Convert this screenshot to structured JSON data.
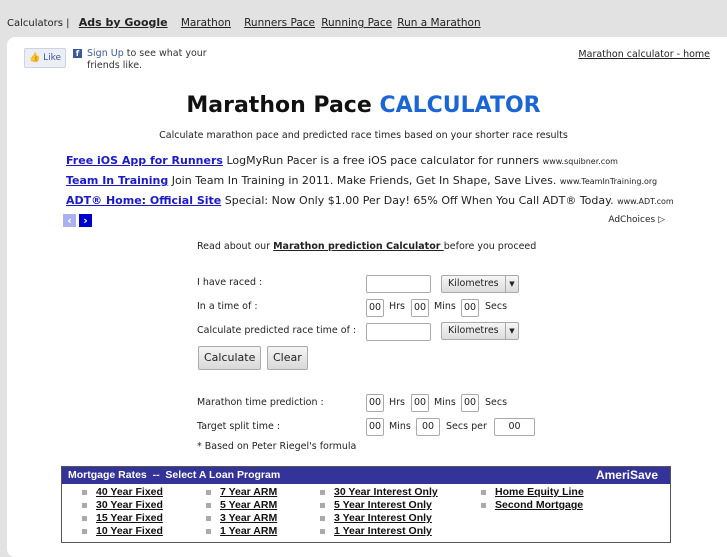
{
  "topnav": {
    "calculators": "Calculators |",
    "ads_by_google": "Ads by Google",
    "links": [
      "Marathon",
      "Runners Pace",
      "Running Pace",
      "Run a Marathon"
    ]
  },
  "social": {
    "like": "Like",
    "signup": "Sign Up",
    "signup_rest": " to see what your friends like."
  },
  "home_link": "Marathon calculator - home",
  "title": {
    "part1": "Marathon Pace ",
    "part2": "CALCULATOR"
  },
  "subtitle": "Calculate marathon pace and predicted race times based on your shorter race results",
  "ads": [
    {
      "title": "Free iOS App for Runners",
      "text": "LogMyRun Pacer is a free iOS pace calculator for runners",
      "url": "www.squibner.com"
    },
    {
      "title": "Team In Training",
      "text": "Join Team In Training in 2011. Make Friends, Get In Shape, Save Lives.",
      "url": "www.TeamInTraining.org"
    },
    {
      "title": "ADT® Home: Official Site",
      "text": "Special: Now Only $1.00 Per Day! 65% Off When You Call ADT® Today.",
      "url": "www.ADT.com"
    }
  ],
  "adchoices": "AdChoices ▷",
  "form": {
    "read_pre": "Read about our ",
    "read_link": "Marathon prediction Calculator ",
    "read_post": "before you proceed",
    "raced_label": "I have raced :",
    "raced_value": "",
    "raced_unit": "Kilometres",
    "time_label": "In a time of :",
    "hrs": "00",
    "mins": "00",
    "secs": "00",
    "hrs_l": "Hrs",
    "mins_l": "Mins",
    "secs_l": "Secs",
    "predict_label": "Calculate predicted race time of :",
    "predict_value": "",
    "predict_unit": "Kilometres",
    "calculate": "Calculate",
    "clear": "Clear",
    "prediction_label": "Marathon time prediction :",
    "p_hrs": "00",
    "p_mins": "00",
    "p_secs": "00",
    "split_label": "Target split time :",
    "s_mins": "00",
    "s_secs": "00",
    "s_per": "00",
    "secs_per": "Secs per",
    "note": "* Based on Peter Riegel's formula"
  },
  "mortgage": {
    "header": "Mortgage Rates  --  Select A Loan Program",
    "brand": "AmeriSave",
    "cols": [
      [
        "40 Year Fixed",
        "30 Year Fixed",
        "15 Year Fixed",
        "10 Year Fixed"
      ],
      [
        "7 Year ARM",
        "5 Year ARM",
        "3 Year ARM",
        "1 Year ARM"
      ],
      [
        "30 Year Interest Only",
        "5 Year Interest Only",
        "3 Year Interest Only",
        "1 Year Interest Only"
      ],
      [
        "Home Equity Line",
        "Second Mortgage"
      ]
    ]
  }
}
